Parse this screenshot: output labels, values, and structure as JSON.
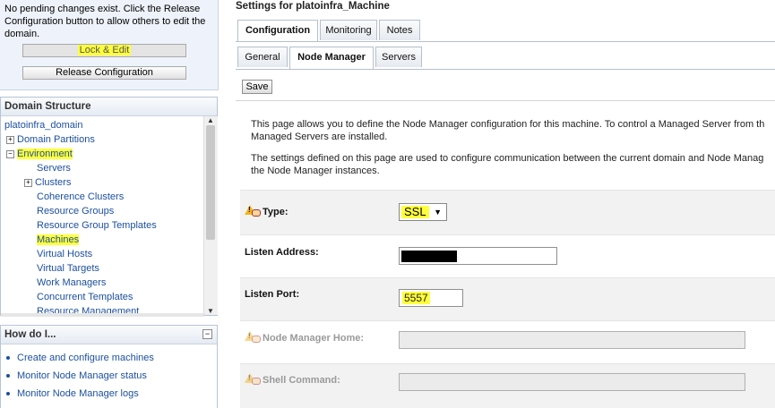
{
  "change_center": {
    "message": "No pending changes exist. Click the Release Configuration button to allow others to edit the domain.",
    "lock_edit_label": "Lock & Edit",
    "release_label": "Release Configuration"
  },
  "domain_structure": {
    "title": "Domain Structure",
    "tree": [
      {
        "label": "platoinfra_domain",
        "expander": "",
        "highlighted": false
      },
      {
        "label": "Domain Partitions",
        "expander": "+",
        "highlighted": false
      },
      {
        "label": "Environment",
        "expander": "-",
        "highlighted": true
      },
      {
        "label": "Servers",
        "expander": "",
        "highlighted": false
      },
      {
        "label": "Clusters",
        "expander": "+",
        "highlighted": false
      },
      {
        "label": "Coherence Clusters",
        "expander": "",
        "highlighted": false
      },
      {
        "label": "Resource Groups",
        "expander": "",
        "highlighted": false
      },
      {
        "label": "Resource Group Templates",
        "expander": "",
        "highlighted": false
      },
      {
        "label": "Machines",
        "expander": "",
        "highlighted": true
      },
      {
        "label": "Virtual Hosts",
        "expander": "",
        "highlighted": false
      },
      {
        "label": "Virtual Targets",
        "expander": "",
        "highlighted": false
      },
      {
        "label": "Work Managers",
        "expander": "",
        "highlighted": false
      },
      {
        "label": "Concurrent Templates",
        "expander": "",
        "highlighted": false
      },
      {
        "label": "Resource Management",
        "expander": "",
        "highlighted": false
      }
    ]
  },
  "how_do_i": {
    "title": "How do I...",
    "collapse_glyph": "−",
    "items": [
      "Create and configure machines",
      "Monitor Node Manager status",
      "Monitor Node Manager logs"
    ]
  },
  "content": {
    "title": "Settings for platoinfra_Machine",
    "tabs": [
      "Configuration",
      "Monitoring",
      "Notes"
    ],
    "active_tab": "Configuration",
    "subtabs": [
      "General",
      "Node Manager",
      "Servers"
    ],
    "active_subtab": "Node Manager",
    "save_label": "Save",
    "description": [
      "This page allows you to define the Node Manager configuration for this machine. To control a Managed Server from th",
      "Managed Servers are installed.",
      "The settings defined on this page are used to configure communication between the current domain and Node Manag",
      "the Node Manager instances."
    ],
    "fields": {
      "type_label": "Type:",
      "type_value": "SSL",
      "listen_address_label": "Listen Address:",
      "listen_address_value": "",
      "listen_port_label": "Listen Port:",
      "listen_port_value": "5557",
      "nm_home_label": "Node Manager Home:",
      "nm_home_value": "",
      "shell_command_label": "Shell Command:",
      "shell_command_value": ""
    }
  },
  "colors": {
    "highlight": "#ffff3c",
    "link": "#1b4f9c",
    "warning": "#f3b41b"
  }
}
